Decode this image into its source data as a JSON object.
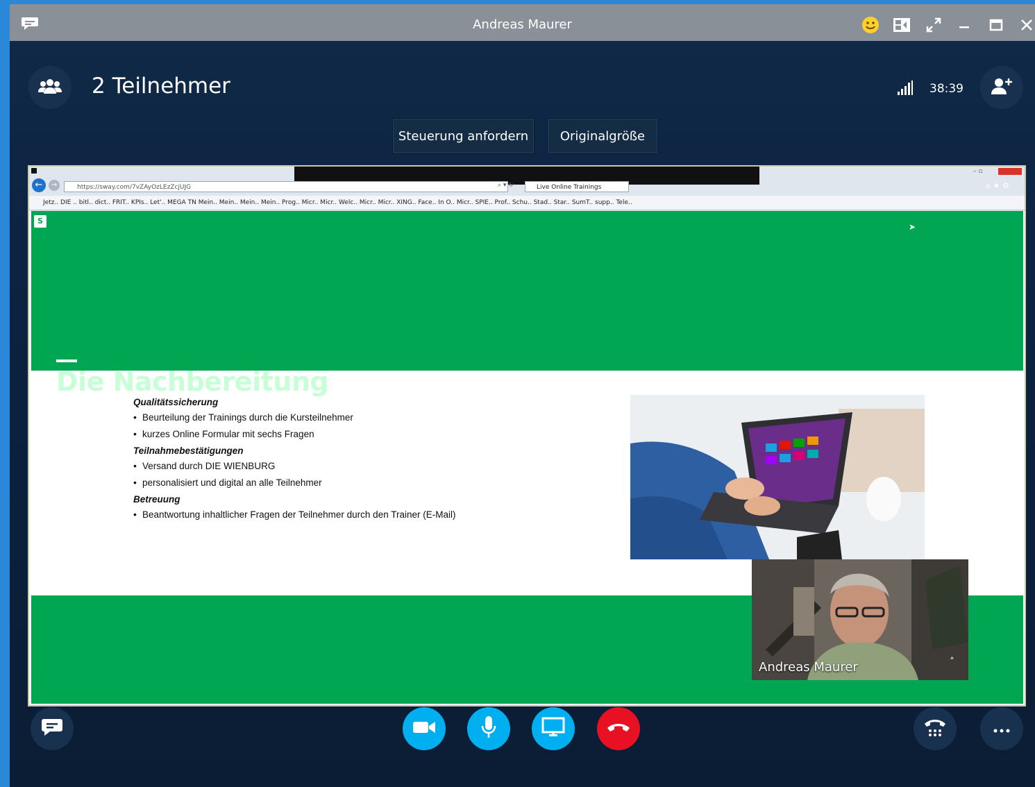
{
  "window": {
    "title": "Andreas Maurer"
  },
  "header": {
    "participants": "2 Teilnehmer",
    "timer": "38:39"
  },
  "controls": {
    "request_control": "Steuerung anfordern",
    "original_size": "Originalgröße"
  },
  "browser": {
    "url": "https://sway.com/7vZAyOzLEzZcjUJG",
    "tab": "Live Online Trainings",
    "favorites": "Jetz..  DIE ..  bitl..  dict..  FRIT..  KPIs..  Let'..  MEGA  TN Mein..  Mein..  Mein..  Mein..  Prog..  Micr..  Micr..  Welc..  Micr..  Micr..  XING..  Face..  In O..  Micr..  SPIE..  Prof..  Schu..  Stad..  Star..  SumT..  supp..  Tele.."
  },
  "slide": {
    "title": "Die Nachbereitung",
    "sections": [
      {
        "heading": "Qualitätssicherung",
        "bullets": [
          "Beurteilung der Trainings durch die Kursteilnehmer",
          "kurzes Online Formular mit sechs Fragen"
        ]
      },
      {
        "heading": "Teilnahmebestätigungen",
        "bullets": [
          "Versand durch DIE WIENBURG",
          "personalisiert und digital an alle Teilnehmer"
        ]
      },
      {
        "heading": "Betreuung",
        "bullets": [
          "Beantwortung inhaltlicher Fragen der Teilnehmer durch den Trainer (E-Mail)"
        ]
      }
    ]
  },
  "webcam": {
    "name": "Andreas Maurer"
  },
  "icons": {
    "chat": "chat-icon",
    "emoji": "emoji-icon",
    "layout": "layout-icon",
    "fullscreen": "fullscreen-icon",
    "minimize": "minimize-icon",
    "maximize": "maximize-icon",
    "close": "close-icon",
    "participants": "people-icon",
    "signal": "signal-icon",
    "add_person": "add-person-icon",
    "video": "video-icon",
    "mic": "mic-icon",
    "screen": "screen-share-icon",
    "hangup": "hangup-icon",
    "dialpad": "dialpad-icon",
    "more": "more-icon"
  },
  "colors": {
    "slide_green": "#00a651",
    "call_blue": "#00aff0",
    "hangup_red": "#e81123",
    "title_green": "#c7ffd6"
  }
}
